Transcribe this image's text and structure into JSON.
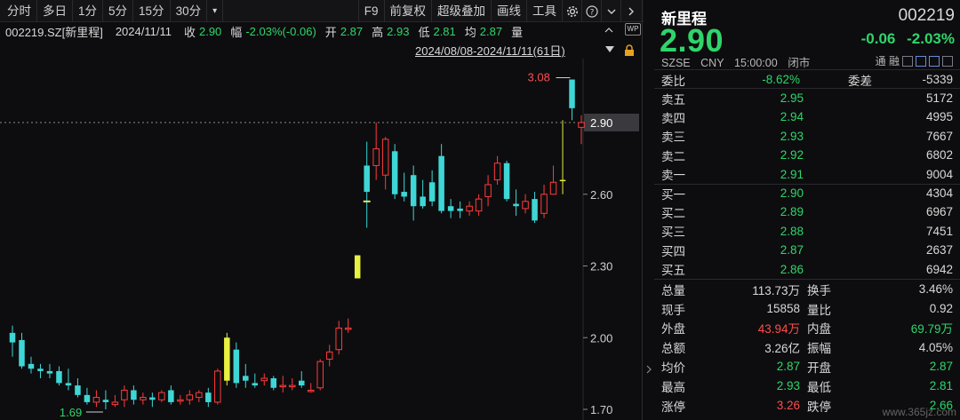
{
  "toolbar": {
    "periods": [
      "分时",
      "多日",
      "1分",
      "5分",
      "15分",
      "30分"
    ],
    "tools": [
      "F9",
      "前复权",
      "超级叠加",
      "画线",
      "工具"
    ]
  },
  "info": {
    "code_name": "002219.SZ[新里程]",
    "date": "2024/11/11",
    "close_label": "收",
    "close": "2.90",
    "amp_label": "幅",
    "amp": "-2.03%(-0.06)",
    "open_label": "开",
    "open": "2.87",
    "high_label": "高",
    "high": "2.93",
    "low_label": "低",
    "low": "2.81",
    "avg_label": "均",
    "avg": "2.87",
    "vol_label": "量"
  },
  "daterange": "2024/08/08-2024/11/11(61日)",
  "chart_data": {
    "type": "candlestick",
    "y_ticks": [
      "2.90",
      "2.60",
      "2.30",
      "2.00",
      "1.70"
    ],
    "current_price_label": "2.90",
    "max_label": "3.08",
    "min_label": "1.69",
    "ylim": [
      1.7,
      3.25
    ],
    "candles": [
      {
        "o": 2.02,
        "h": 2.05,
        "l": 1.92,
        "c": 1.98
      },
      {
        "o": 1.99,
        "h": 2.02,
        "l": 1.87,
        "c": 1.88
      },
      {
        "o": 1.89,
        "h": 1.92,
        "l": 1.85,
        "c": 1.87
      },
      {
        "o": 1.87,
        "h": 1.89,
        "l": 1.83,
        "c": 1.86
      },
      {
        "o": 1.86,
        "h": 1.89,
        "l": 1.83,
        "c": 1.85
      },
      {
        "o": 1.86,
        "h": 1.88,
        "l": 1.8,
        "c": 1.81
      },
      {
        "o": 1.81,
        "h": 1.87,
        "l": 1.78,
        "c": 1.8
      },
      {
        "o": 1.8,
        "h": 1.83,
        "l": 1.75,
        "c": 1.76
      },
      {
        "o": 1.76,
        "h": 1.79,
        "l": 1.72,
        "c": 1.73
      },
      {
        "o": 1.73,
        "h": 1.78,
        "l": 1.71,
        "c": 1.75
      },
      {
        "o": 1.74,
        "h": 1.78,
        "l": 1.7,
        "c": 1.73
      },
      {
        "o": 1.72,
        "h": 1.76,
        "l": 1.71,
        "c": 1.73
      },
      {
        "o": 1.74,
        "h": 1.8,
        "l": 1.71,
        "c": 1.78
      },
      {
        "o": 1.78,
        "h": 1.8,
        "l": 1.72,
        "c": 1.74
      },
      {
        "o": 1.74,
        "h": 1.77,
        "l": 1.72,
        "c": 1.75
      },
      {
        "o": 1.75,
        "h": 1.77,
        "l": 1.71,
        "c": 1.74
      },
      {
        "o": 1.74,
        "h": 1.78,
        "l": 1.73,
        "c": 1.77
      },
      {
        "o": 1.78,
        "h": 1.8,
        "l": 1.72,
        "c": 1.73
      },
      {
        "o": 1.74,
        "h": 1.76,
        "l": 1.72,
        "c": 1.74
      },
      {
        "o": 1.74,
        "h": 1.78,
        "l": 1.72,
        "c": 1.76
      },
      {
        "o": 1.75,
        "h": 1.78,
        "l": 1.73,
        "c": 1.77
      },
      {
        "o": 1.77,
        "h": 1.79,
        "l": 1.71,
        "c": 1.73
      },
      {
        "o": 1.73,
        "h": 1.87,
        "l": 1.72,
        "c": 1.86
      },
      {
        "o": 1.82,
        "h": 2.02,
        "l": 1.8,
        "c": 2.0
      },
      {
        "o": 1.95,
        "h": 1.98,
        "l": 1.79,
        "c": 1.81
      },
      {
        "o": 1.84,
        "h": 1.89,
        "l": 1.79,
        "c": 1.82
      },
      {
        "o": 1.81,
        "h": 1.85,
        "l": 1.79,
        "c": 1.8
      },
      {
        "o": 1.82,
        "h": 1.85,
        "l": 1.8,
        "c": 1.83
      },
      {
        "o": 1.83,
        "h": 1.84,
        "l": 1.78,
        "c": 1.79
      },
      {
        "o": 1.8,
        "h": 1.84,
        "l": 1.77,
        "c": 1.8
      },
      {
        "o": 1.8,
        "h": 1.83,
        "l": 1.78,
        "c": 1.8
      },
      {
        "o": 1.82,
        "h": 1.86,
        "l": 1.79,
        "c": 1.8
      },
      {
        "o": 1.78,
        "h": 1.81,
        "l": 1.77,
        "c": 1.78
      },
      {
        "o": 1.79,
        "h": 1.91,
        "l": 1.78,
        "c": 1.9
      },
      {
        "o": 1.91,
        "h": 1.97,
        "l": 1.88,
        "c": 1.94
      },
      {
        "o": 1.95,
        "h": 2.07,
        "l": 1.93,
        "c": 2.04
      },
      {
        "o": 2.04,
        "h": 2.08,
        "l": 2.02,
        "c": 2.04
      },
      {
        "o": 2.3,
        "h": 2.3,
        "l": 2.3,
        "c": 2.3
      },
      {
        "o": 2.72,
        "h": 2.82,
        "l": 2.46,
        "c": 2.61
      },
      {
        "o": 2.72,
        "h": 2.9,
        "l": 2.66,
        "c": 2.79
      },
      {
        "o": 2.68,
        "h": 2.84,
        "l": 2.62,
        "c": 2.83
      },
      {
        "o": 2.78,
        "h": 2.81,
        "l": 2.58,
        "c": 2.6
      },
      {
        "o": 2.61,
        "h": 2.69,
        "l": 2.57,
        "c": 2.59
      },
      {
        "o": 2.68,
        "h": 2.72,
        "l": 2.49,
        "c": 2.55
      },
      {
        "o": 2.59,
        "h": 2.66,
        "l": 2.54,
        "c": 2.55
      },
      {
        "o": 2.65,
        "h": 2.7,
        "l": 2.55,
        "c": 2.57
      },
      {
        "o": 2.76,
        "h": 2.81,
        "l": 2.52,
        "c": 2.53
      },
      {
        "o": 2.55,
        "h": 2.58,
        "l": 2.5,
        "c": 2.53
      },
      {
        "o": 2.54,
        "h": 2.57,
        "l": 2.5,
        "c": 2.53
      },
      {
        "o": 2.53,
        "h": 2.57,
        "l": 2.51,
        "c": 2.55
      },
      {
        "o": 2.53,
        "h": 2.6,
        "l": 2.51,
        "c": 2.58
      },
      {
        "o": 2.59,
        "h": 2.68,
        "l": 2.55,
        "c": 2.64
      },
      {
        "o": 2.66,
        "h": 2.76,
        "l": 2.64,
        "c": 2.73
      },
      {
        "o": 2.73,
        "h": 2.74,
        "l": 2.57,
        "c": 2.58
      },
      {
        "o": 2.56,
        "h": 2.62,
        "l": 2.51,
        "c": 2.55
      },
      {
        "o": 2.54,
        "h": 2.6,
        "l": 2.52,
        "c": 2.57
      },
      {
        "o": 2.58,
        "h": 2.61,
        "l": 2.48,
        "c": 2.49
      },
      {
        "o": 2.52,
        "h": 2.64,
        "l": 2.5,
        "c": 2.6
      },
      {
        "o": 2.6,
        "h": 2.72,
        "l": 2.6,
        "c": 2.65
      },
      {
        "o": 2.66,
        "h": 2.91,
        "l": 2.6,
        "c": 2.66
      },
      {
        "o": 3.08,
        "h": 3.08,
        "l": 2.91,
        "c": 2.96
      },
      {
        "o": 2.88,
        "h": 2.93,
        "l": 2.81,
        "c": 2.9
      }
    ],
    "limit_up_idx": [
      23,
      37,
      59
    ],
    "ma_marks": [
      {
        "idx": 37,
        "value": 2.57
      }
    ]
  },
  "panel": {
    "name": "新里程",
    "code": "002219",
    "price": "2.90",
    "change": "-0.06",
    "change_pct": "-2.03%",
    "market": "SZSE",
    "currency": "CNY",
    "time": "15:00:00",
    "status": "闭市",
    "badge": "通 融",
    "weibi_label": "委比",
    "weibi": "-8.62%",
    "weicha_label": "委差",
    "weicha": "-5339",
    "asks": [
      {
        "label": "卖五",
        "price": "2.95",
        "vol": "5172"
      },
      {
        "label": "卖四",
        "price": "2.94",
        "vol": "4995"
      },
      {
        "label": "卖三",
        "price": "2.93",
        "vol": "7667"
      },
      {
        "label": "卖二",
        "price": "2.92",
        "vol": "6802"
      },
      {
        "label": "卖一",
        "price": "2.91",
        "vol": "9004"
      }
    ],
    "bids": [
      {
        "label": "买一",
        "price": "2.90",
        "vol": "4304"
      },
      {
        "label": "买二",
        "price": "2.89",
        "vol": "6967"
      },
      {
        "label": "买三",
        "price": "2.88",
        "vol": "7451"
      },
      {
        "label": "买四",
        "price": "2.87",
        "vol": "2637"
      },
      {
        "label": "买五",
        "price": "2.86",
        "vol": "6942"
      }
    ],
    "stats": [
      {
        "l1": "总量",
        "v1": "113.73万",
        "c1": "w",
        "l2": "换手",
        "v2": "3.46%",
        "c2": "w"
      },
      {
        "l1": "现手",
        "v1": "15858",
        "c1": "w",
        "l2": "量比",
        "v2": "0.92",
        "c2": "w"
      },
      {
        "l1": "外盘",
        "v1": "43.94万",
        "c1": "r",
        "l2": "内盘",
        "v2": "69.79万",
        "c2": "g"
      },
      {
        "l1": "总额",
        "v1": "3.26亿",
        "c1": "w",
        "l2": "振幅",
        "v2": "4.05%",
        "c2": "w"
      },
      {
        "l1": "均价",
        "v1": "2.87",
        "c1": "g",
        "l2": "开盘",
        "v2": "2.87",
        "c2": "g"
      },
      {
        "l1": "最高",
        "v1": "2.93",
        "c1": "g",
        "l2": "最低",
        "v2": "2.81",
        "c2": "g"
      },
      {
        "l1": "涨停",
        "v1": "3.26",
        "c1": "r",
        "l2": "跌停",
        "v2": "2.66",
        "c2": "g"
      }
    ],
    "watermark": "www.365jz.com"
  },
  "colors": {
    "up": "#ff3b3b",
    "down": "#3fd6d6",
    "limit": "#e8f040",
    "green": "#2fd56a"
  }
}
